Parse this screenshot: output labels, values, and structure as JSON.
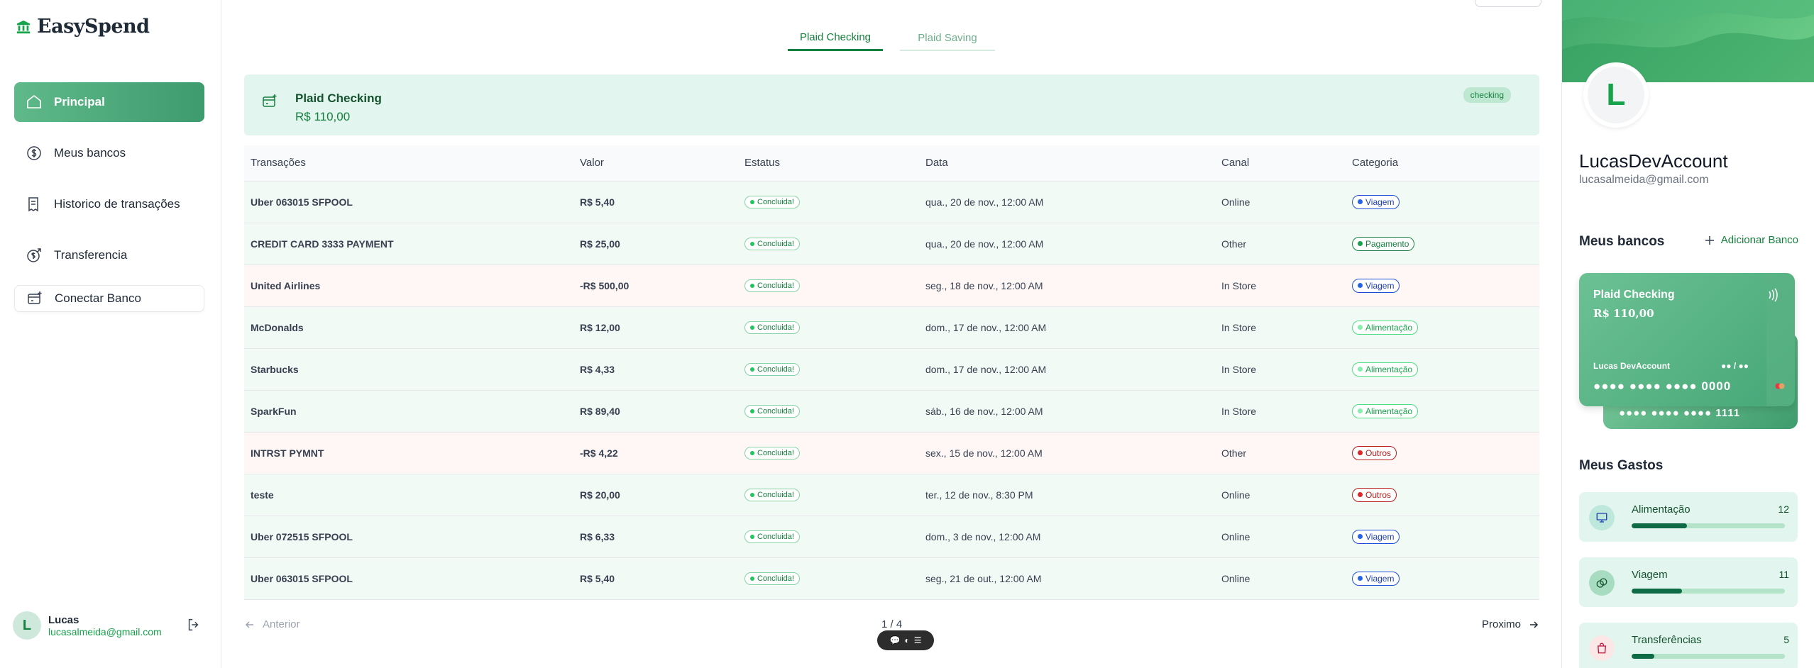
{
  "app": {
    "brand": "EasySpend"
  },
  "sidebar": {
    "items": [
      {
        "label": "Principal",
        "icon": "home-icon",
        "active": true
      },
      {
        "label": "Meus bancos",
        "icon": "dollar-circle-icon"
      },
      {
        "label": "Historico de transações",
        "icon": "receipt-icon"
      },
      {
        "label": "Transferencia",
        "icon": "money-send-icon"
      },
      {
        "label": "Conectar Banco",
        "icon": "bank-card-plus-icon"
      }
    ],
    "user": {
      "initial": "L",
      "name": "Lucas",
      "email": "lucasalmeida@gmail.com"
    }
  },
  "tabs": [
    {
      "label": "Plaid Checking",
      "active": true
    },
    {
      "label": "Plaid Saving",
      "active": false
    }
  ],
  "account": {
    "name": "Plaid Checking",
    "balance": "R$ 110,00",
    "type": "checking"
  },
  "table": {
    "headers": [
      "Transações",
      "Valor",
      "Estatus",
      "Data",
      "Canal",
      "Categoria"
    ],
    "rows": [
      {
        "name": "Uber 063015 SFPOOL",
        "amount": "R$ 5,40",
        "type": "pos",
        "status": "Concluida!",
        "date": "qua., 20 de nov., 12:00 AM",
        "channel": "Online",
        "category": "Viagem",
        "catStyle": "blue"
      },
      {
        "name": "CREDIT CARD 3333 PAYMENT",
        "amount": "R$ 25,00",
        "type": "pos",
        "status": "Concluida!",
        "date": "qua., 20 de nov., 12:00 AM",
        "channel": "Other",
        "category": "Pagamento",
        "catStyle": "green"
      },
      {
        "name": "United Airlines",
        "amount": "-R$ 500,00",
        "type": "neg",
        "status": "Concluida!",
        "date": "seg., 18 de nov., 12:00 AM",
        "channel": "In Store",
        "category": "Viagem",
        "catStyle": "blue"
      },
      {
        "name": "McDonalds",
        "amount": "R$ 12,00",
        "type": "pos",
        "status": "Concluida!",
        "date": "dom., 17 de nov., 12:00 AM",
        "channel": "In Store",
        "category": "Alimentação",
        "catStyle": "light"
      },
      {
        "name": "Starbucks",
        "amount": "R$ 4,33",
        "type": "pos",
        "status": "Concluida!",
        "date": "dom., 17 de nov., 12:00 AM",
        "channel": "In Store",
        "category": "Alimentação",
        "catStyle": "light"
      },
      {
        "name": "SparkFun",
        "amount": "R$ 89,40",
        "type": "pos",
        "status": "Concluida!",
        "date": "sáb., 16 de nov., 12:00 AM",
        "channel": "In Store",
        "category": "Alimentação",
        "catStyle": "light"
      },
      {
        "name": "INTRST PYMNT",
        "amount": "-R$ 4,22",
        "type": "neg",
        "status": "Concluida!",
        "date": "sex., 15 de nov., 12:00 AM",
        "channel": "Other",
        "category": "Outros",
        "catStyle": "red"
      },
      {
        "name": "teste",
        "amount": "R$ 20,00",
        "type": "pos",
        "status": "Concluida!",
        "date": "ter., 12 de nov., 8:30 PM",
        "channel": "Online",
        "category": "Outros",
        "catStyle": "red"
      },
      {
        "name": "Uber 072515 SFPOOL",
        "amount": "R$ 6,33",
        "type": "pos",
        "status": "Concluida!",
        "date": "dom., 3 de nov., 12:00 AM",
        "channel": "Online",
        "category": "Viagem",
        "catStyle": "blue"
      },
      {
        "name": "Uber 063015 SFPOOL",
        "amount": "R$ 5,40",
        "type": "pos",
        "status": "Concluida!",
        "date": "seg., 21 de out., 12:00 AM",
        "channel": "Online",
        "category": "Viagem",
        "catStyle": "blue"
      }
    ]
  },
  "pagination": {
    "prev": "Anterior",
    "page": "1 / 4",
    "next": "Proximo"
  },
  "profile": {
    "initial": "L",
    "name": "LucasDevAccount",
    "email": "lucasalmeida@gmail.com"
  },
  "banks": {
    "title": "Meus bancos",
    "add": "Adicionar Banco",
    "card": {
      "name": "Plaid Checking",
      "balance": "R$ 110,00",
      "holder": "Lucas DevAccount",
      "expiry": "●● / ●●",
      "number": "●●●● ●●●● ●●●● 0000"
    },
    "back_card_number": "●●●● ●●●● ●●●● 1111"
  },
  "spending": {
    "title": "Meus Gastos",
    "items": [
      {
        "label": "Alimentação",
        "count": "12",
        "progress": 0.36,
        "icon": "monitor-icon"
      },
      {
        "label": "Viagem",
        "count": "11",
        "progress": 0.33,
        "icon": "coins-icon"
      },
      {
        "label": "Transferências",
        "count": "5",
        "progress": 0.15,
        "icon": "shopping-bag-icon"
      }
    ]
  },
  "colors": {
    "accent": "#15803d",
    "positive": "#16a34a",
    "negative": "#ef4444"
  }
}
